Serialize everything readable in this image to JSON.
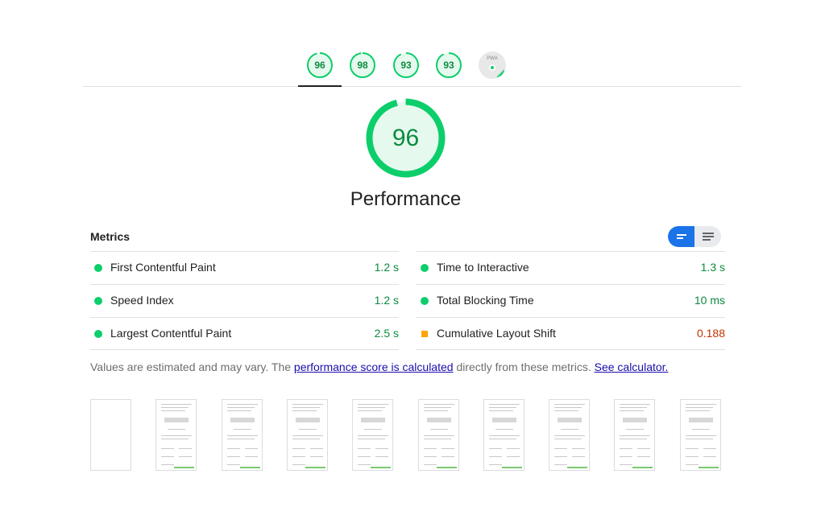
{
  "tabs": [
    {
      "label": "96",
      "color": "#0cce6b"
    },
    {
      "label": "98",
      "color": "#0cce6b"
    },
    {
      "label": "93",
      "color": "#0cce6b"
    },
    {
      "label": "93",
      "color": "#0cce6b"
    }
  ],
  "pwa": {
    "label": "PWA"
  },
  "main": {
    "score": "96",
    "score_fraction": 0.96,
    "title": "Performance"
  },
  "metrics": {
    "heading": "Metrics",
    "items": [
      {
        "label": "First Contentful Paint",
        "value": "1.2 s",
        "status": "good"
      },
      {
        "label": "Time to Interactive",
        "value": "1.3 s",
        "status": "good"
      },
      {
        "label": "Speed Index",
        "value": "1.2 s",
        "status": "good"
      },
      {
        "label": "Total Blocking Time",
        "value": "10 ms",
        "status": "good"
      },
      {
        "label": "Largest Contentful Paint",
        "value": "2.5 s",
        "status": "good"
      },
      {
        "label": "Cumulative Layout Shift",
        "value": "0.188",
        "status": "average"
      }
    ]
  },
  "footnote": {
    "text_before": "Values are estimated and may vary. The ",
    "link1": "performance score is calculated",
    "text_middle": " directly from these metrics. ",
    "link2": "See calculator."
  },
  "filmstrip": {
    "frame_count": 10
  },
  "colors": {
    "good": "#0cce6b",
    "good_text": "#0c8b3f",
    "average": "#ffa400",
    "average_text": "#c33300",
    "accent": "#1a73e8"
  },
  "icons": {
    "view_toggle_active": "lines-short-icon",
    "view_toggle_inactive": "lines-long-icon"
  }
}
